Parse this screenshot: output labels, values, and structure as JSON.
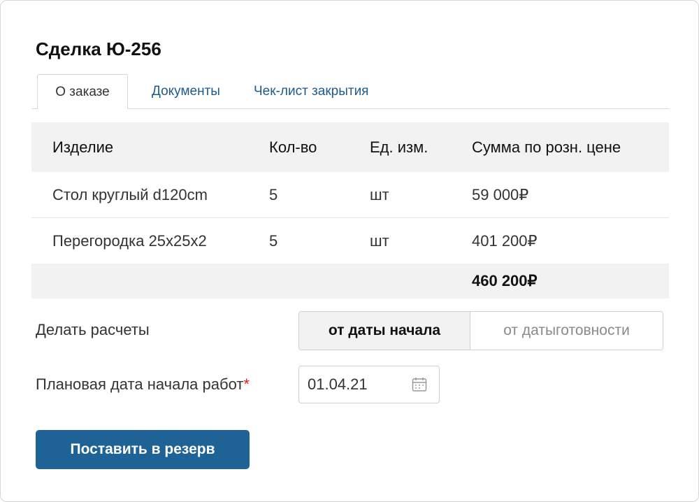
{
  "deal": {
    "title": "Сделка Ю-256"
  },
  "tabs": [
    {
      "label": "О заказе",
      "active": true
    },
    {
      "label": "Документы",
      "active": false
    },
    {
      "label": "Чек-лист закрытия",
      "active": false
    }
  ],
  "table": {
    "headers": [
      "Изделие",
      "Кол-во",
      "Ед. изм.",
      "Сумма по розн. цене"
    ],
    "rows": [
      [
        "Стол круглый d120cm",
        "5",
        "шт",
        "59 000₽"
      ],
      [
        "Перегородка 25х25х2",
        "5",
        "шт",
        "401 200₽"
      ]
    ],
    "total": "460 200₽"
  },
  "calc": {
    "label": "Делать расчеты",
    "options": [
      "от даты начала",
      "от датыготовности"
    ],
    "selected": "от даты начала"
  },
  "start_date": {
    "label": "Плановая дата начала работ",
    "required_mark": "*",
    "value": "01.04.21",
    "icon": "calendar-icon"
  },
  "actions": {
    "reserve_label": "Поставить в резерв"
  },
  "colors": {
    "accent": "#1f6396",
    "link": "#1f5a8c",
    "required": "#e02020",
    "header_bg": "#f2f2f2"
  }
}
